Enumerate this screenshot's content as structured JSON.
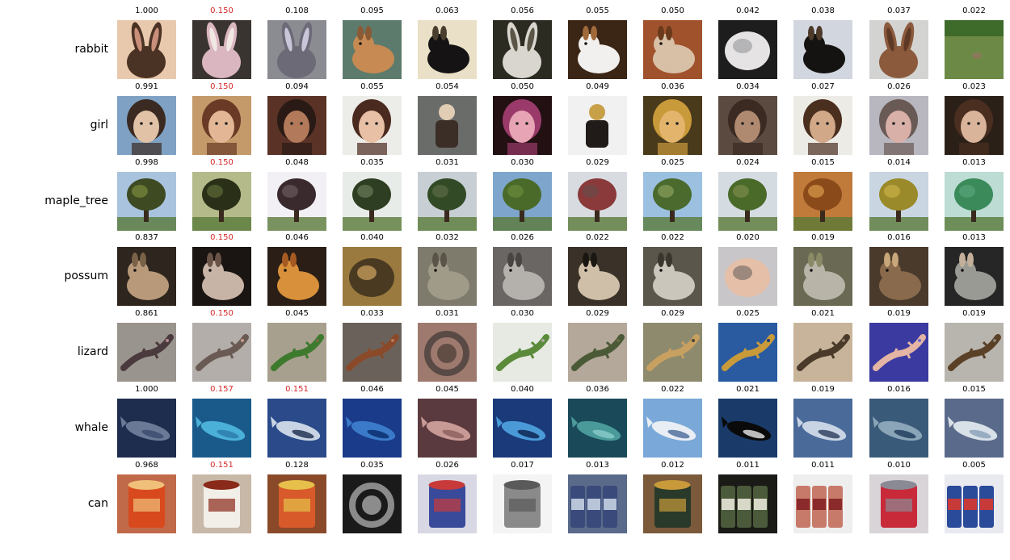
{
  "rows": [
    {
      "label": "rabbit",
      "scores": [
        "1.000",
        "0.150",
        "0.108",
        "0.095",
        "0.063",
        "0.056",
        "0.055",
        "0.050",
        "0.042",
        "0.038",
        "0.037",
        "0.022"
      ],
      "highlight": [
        1
      ],
      "thumbs": [
        {
          "bg": "#e9c9ad",
          "fg": "#4a3224",
          "accent": "#c98f7a",
          "shape": "ears"
        },
        {
          "bg": "#3a3430",
          "fg": "#d9b6c0",
          "accent": "#f1e8e4",
          "shape": "ears"
        },
        {
          "bg": "#8b8c92",
          "fg": "#6d6a78",
          "accent": "#c8c6d8",
          "shape": "ears"
        },
        {
          "bg": "#5d7b6c",
          "fg": "#c78a52",
          "accent": "#8a5a36",
          "shape": "animal"
        },
        {
          "bg": "#eadfc7",
          "fg": "#151313",
          "accent": "#4a3f2e",
          "shape": "animal"
        },
        {
          "bg": "#2b2b22",
          "fg": "#d8d6cf",
          "accent": "#5a5546",
          "shape": "ears"
        },
        {
          "bg": "#3b2616",
          "fg": "#f2f0ee",
          "accent": "#a06a3a",
          "shape": "animal"
        },
        {
          "bg": "#a0522d",
          "fg": "#d8c0a6",
          "accent": "#6b3a1c",
          "shape": "animal"
        },
        {
          "bg": "#1d1d1d",
          "fg": "#e6e3e4",
          "accent": "#a9a7aa",
          "shape": "blob"
        },
        {
          "bg": "#d2d6df",
          "fg": "#151311",
          "accent": "#4d3a2a",
          "shape": "animal"
        },
        {
          "bg": "#d3d4d2",
          "fg": "#8b5a3c",
          "accent": "#5e3a26",
          "shape": "ears"
        },
        {
          "bg": "#3e6a2a",
          "fg": "#6c8a46",
          "accent": "#8a7a5a",
          "shape": "field"
        }
      ]
    },
    {
      "label": "girl",
      "scores": [
        "0.991",
        "0.150",
        "0.094",
        "0.055",
        "0.054",
        "0.050",
        "0.049",
        "0.036",
        "0.034",
        "0.027",
        "0.026",
        "0.023"
      ],
      "highlight": [
        1
      ],
      "thumbs": [
        {
          "bg": "#7fa2c4",
          "fg": "#3a2a22",
          "accent": "#e2c2a6",
          "shape": "face"
        },
        {
          "bg": "#c49a6a",
          "fg": "#6a3a26",
          "accent": "#e3b796",
          "shape": "face"
        },
        {
          "bg": "#5a3226",
          "fg": "#2a1a16",
          "accent": "#b27a5a",
          "shape": "face"
        },
        {
          "bg": "#ecece8",
          "fg": "#4a2a1e",
          "accent": "#e8c0a6",
          "shape": "face"
        },
        {
          "bg": "#6a6c6a",
          "fg": "#3a2e26",
          "accent": "#e0cdb4",
          "shape": "figure"
        },
        {
          "bg": "#221012",
          "fg": "#9a3a6a",
          "accent": "#e6a4b4",
          "shape": "face"
        },
        {
          "bg": "#f1f1f1",
          "fg": "#201a18",
          "accent": "#c8a048",
          "shape": "figure"
        },
        {
          "bg": "#4a3a1c",
          "fg": "#c99a3a",
          "accent": "#e3b46c",
          "shape": "face"
        },
        {
          "bg": "#5a4a40",
          "fg": "#3a2a22",
          "accent": "#b08a70",
          "shape": "face"
        },
        {
          "bg": "#ecebe6",
          "fg": "#4a2e1e",
          "accent": "#d1a888",
          "shape": "face"
        },
        {
          "bg": "#b8b7c0",
          "fg": "#6a5a56",
          "accent": "#d8b0a8",
          "shape": "face"
        },
        {
          "bg": "#2a2018",
          "fg": "#4a2e20",
          "accent": "#d9b49a",
          "shape": "face"
        }
      ]
    },
    {
      "label": "maple_tree",
      "scores": [
        "0.998",
        "0.150",
        "0.048",
        "0.035",
        "0.031",
        "0.030",
        "0.029",
        "0.025",
        "0.024",
        "0.015",
        "0.014",
        "0.013"
      ],
      "highlight": [
        1
      ],
      "thumbs": [
        {
          "bg": "#a9c3de",
          "fg": "#3d4a22",
          "accent": "#7a8a3a",
          "shape": "tree"
        },
        {
          "bg": "#b4ba8a",
          "fg": "#2a3018",
          "accent": "#5e6a36",
          "shape": "tree"
        },
        {
          "bg": "#f2f0f4",
          "fg": "#3a2a2e",
          "accent": "#6a5a5e",
          "shape": "tree"
        },
        {
          "bg": "#e8ece8",
          "fg": "#2e3e22",
          "accent": "#6a7a5a",
          "shape": "tree"
        },
        {
          "bg": "#c8cfd4",
          "fg": "#324a26",
          "accent": "#5a6a46",
          "shape": "tree"
        },
        {
          "bg": "#7ea6cc",
          "fg": "#4a6a2a",
          "accent": "#6a8a3a",
          "shape": "tree"
        },
        {
          "bg": "#d8dbe0",
          "fg": "#8a3a3a",
          "accent": "#6a4a4a",
          "shape": "tree"
        },
        {
          "bg": "#9cc0e0",
          "fg": "#4a6a2e",
          "accent": "#8aa05a",
          "shape": "tree"
        },
        {
          "bg": "#d4dce2",
          "fg": "#4a6a2a",
          "accent": "#7a8a4a",
          "shape": "tree"
        },
        {
          "bg": "#c07a3a",
          "fg": "#8a4a1a",
          "accent": "#d89a4a",
          "shape": "tree"
        },
        {
          "bg": "#c9d6e2",
          "fg": "#9a8a2a",
          "accent": "#c8b048",
          "shape": "tree"
        },
        {
          "bg": "#bcdcd4",
          "fg": "#3a8a5a",
          "accent": "#5aa47a",
          "shape": "tree"
        }
      ]
    },
    {
      "label": "possum",
      "scores": [
        "0.837",
        "0.150",
        "0.046",
        "0.040",
        "0.032",
        "0.026",
        "0.022",
        "0.022",
        "0.020",
        "0.019",
        "0.016",
        "0.013"
      ],
      "highlight": [
        1
      ],
      "thumbs": [
        {
          "bg": "#2e261e",
          "fg": "#b89a7a",
          "accent": "#7a6248",
          "shape": "animal"
        },
        {
          "bg": "#1a1512",
          "fg": "#c8b4a6",
          "accent": "#6a5448",
          "shape": "animal"
        },
        {
          "bg": "#2a1e16",
          "fg": "#d8903a",
          "accent": "#a45a22",
          "shape": "animal"
        },
        {
          "bg": "#9a7a3e",
          "fg": "#4a3a22",
          "accent": "#c09a5a",
          "shape": "blob"
        },
        {
          "bg": "#7e7a6c",
          "fg": "#a09a88",
          "accent": "#5a5448",
          "shape": "animal"
        },
        {
          "bg": "#6a6664",
          "fg": "#b4b0ac",
          "accent": "#484442",
          "shape": "animal"
        },
        {
          "bg": "#3a3228",
          "fg": "#d0bfa8",
          "accent": "#1a1612",
          "shape": "animal"
        },
        {
          "bg": "#5a564c",
          "fg": "#cbc6bc",
          "accent": "#3a362e",
          "shape": "animal"
        },
        {
          "bg": "#c8c6c8",
          "fg": "#e6bfa8",
          "accent": "#8a7a70",
          "shape": "blob"
        },
        {
          "bg": "#6a6a54",
          "fg": "#b8b4a8",
          "accent": "#8a8a66",
          "shape": "animal"
        },
        {
          "bg": "#4a3a2c",
          "fg": "#8a6a4c",
          "accent": "#c8a87a",
          "shape": "animal"
        },
        {
          "bg": "#262626",
          "fg": "#9a9a94",
          "accent": "#c4b09a",
          "shape": "animal"
        }
      ]
    },
    {
      "label": "lizard",
      "scores": [
        "0.861",
        "0.150",
        "0.045",
        "0.033",
        "0.031",
        "0.030",
        "0.029",
        "0.029",
        "0.025",
        "0.021",
        "0.019",
        "0.019"
      ],
      "highlight": [
        1
      ],
      "thumbs": [
        {
          "bg": "#9a948e",
          "fg": "#4a3a3e",
          "accent": "#b88a8e",
          "shape": "lizard"
        },
        {
          "bg": "#b4aeaa",
          "fg": "#6a5a54",
          "accent": "#c89a86",
          "shape": "lizard"
        },
        {
          "bg": "#a8a08e",
          "fg": "#3e7a2e",
          "accent": "#7a6a4e",
          "shape": "lizard"
        },
        {
          "bg": "#6a625a",
          "fg": "#8a4a2a",
          "accent": "#b87a5a",
          "shape": "lizard"
        },
        {
          "bg": "#9e7a6e",
          "fg": "#5a4a46",
          "accent": "#3a2e2a",
          "shape": "ring"
        },
        {
          "bg": "#e6eae2",
          "fg": "#5a8a3a",
          "accent": "#a8a8a0",
          "shape": "lizard"
        },
        {
          "bg": "#b4a89a",
          "fg": "#4a5a36",
          "accent": "#6a6a4a",
          "shape": "lizard"
        },
        {
          "bg": "#8e8a6e",
          "fg": "#c8a060",
          "accent": "#4a4632",
          "shape": "lizard"
        },
        {
          "bg": "#2a5aa0",
          "fg": "#c89a3a",
          "accent": "#1a3a7a",
          "shape": "lizard"
        },
        {
          "bg": "#c8b49a",
          "fg": "#4a3a2a",
          "accent": "#8a7a62",
          "shape": "lizard"
        },
        {
          "bg": "#3a3aa0",
          "fg": "#e4b4a4",
          "accent": "#6a6ad0",
          "shape": "lizard"
        },
        {
          "bg": "#b8b4ae",
          "fg": "#5a4026",
          "accent": "#8a8278",
          "shape": "lizard"
        }
      ]
    },
    {
      "label": "whale",
      "scores": [
        "1.000",
        "0.157",
        "0.151",
        "0.046",
        "0.045",
        "0.040",
        "0.036",
        "0.022",
        "0.021",
        "0.019",
        "0.016",
        "0.015"
      ],
      "highlight": [
        1,
        2
      ],
      "thumbs": [
        {
          "bg": "#1e2c4e",
          "fg": "#6a7a96",
          "accent": "#3a4a6e",
          "shape": "whale"
        },
        {
          "bg": "#1a5a8a",
          "fg": "#4ab0d8",
          "accent": "#2a7aaa",
          "shape": "whale"
        },
        {
          "bg": "#2a4a8a",
          "fg": "#c8d4e4",
          "accent": "#1a2a4a",
          "shape": "whale"
        },
        {
          "bg": "#1a3a8a",
          "fg": "#3a7ac8",
          "accent": "#0a2a6a",
          "shape": "whale"
        },
        {
          "bg": "#5a3a3e",
          "fg": "#c89a96",
          "accent": "#8a5e5a",
          "shape": "whale"
        },
        {
          "bg": "#1a3a7a",
          "fg": "#4a9ad8",
          "accent": "#0a1e4a",
          "shape": "whale"
        },
        {
          "bg": "#1a4a5a",
          "fg": "#4a9a9a",
          "accent": "#8acaca",
          "shape": "whale"
        },
        {
          "bg": "#7aa8d8",
          "fg": "#e8eef4",
          "accent": "#4a6a9a",
          "shape": "whale"
        },
        {
          "bg": "#1a3a6a",
          "fg": "#0a0a0a",
          "accent": "#e8e8e8",
          "shape": "whale"
        },
        {
          "bg": "#4a6a9a",
          "fg": "#c8d4e4",
          "accent": "#2a3a5a",
          "shape": "whale"
        },
        {
          "bg": "#3a5a7a",
          "fg": "#8aa4b8",
          "accent": "#1a3a5a",
          "shape": "whale"
        },
        {
          "bg": "#5a6a8a",
          "fg": "#d8e0e8",
          "accent": "#8aa0b8",
          "shape": "whale"
        }
      ]
    },
    {
      "label": "can",
      "scores": [
        "0.968",
        "0.151",
        "0.128",
        "0.035",
        "0.026",
        "0.017",
        "0.013",
        "0.012",
        "0.011",
        "0.011",
        "0.010",
        "0.005"
      ],
      "highlight": [
        1
      ],
      "thumbs": [
        {
          "bg": "#c06a4a",
          "fg": "#d84a1e",
          "accent": "#f0c07a",
          "shape": "can"
        },
        {
          "bg": "#c8b8a8",
          "fg": "#f2eee8",
          "accent": "#8a2a1a",
          "shape": "can"
        },
        {
          "bg": "#8a4a2a",
          "fg": "#d85a2a",
          "accent": "#e6c04a",
          "shape": "can"
        },
        {
          "bg": "#1a1a1a",
          "fg": "#8a8a8a",
          "accent": "#d8d8d8",
          "shape": "ring"
        },
        {
          "bg": "#d8d8e4",
          "fg": "#3a4a9a",
          "accent": "#c83a3a",
          "shape": "can"
        },
        {
          "bg": "#f4f4f4",
          "fg": "#8a8a8a",
          "accent": "#5a5a5a",
          "shape": "can"
        },
        {
          "bg": "#5a6a8a",
          "fg": "#3a4a7a",
          "accent": "#b8c4d8",
          "shape": "cans"
        },
        {
          "bg": "#7a5a3a",
          "fg": "#2a3a2a",
          "accent": "#c89a3a",
          "shape": "can"
        },
        {
          "bg": "#1a1a16",
          "fg": "#4a5a3a",
          "accent": "#d8d8c8",
          "shape": "cans"
        },
        {
          "bg": "#eeeeee",
          "fg": "#c87a6a",
          "accent": "#8a2a2a",
          "shape": "cans"
        },
        {
          "bg": "#d8d4d8",
          "fg": "#c82a3a",
          "accent": "#8a8a94",
          "shape": "can"
        },
        {
          "bg": "#e8eaf0",
          "fg": "#2a4a9a",
          "accent": "#c83a3a",
          "shape": "cans"
        }
      ]
    }
  ],
  "colors": {
    "highlight": "#d62728",
    "score": "#000000",
    "label": "#000000"
  }
}
